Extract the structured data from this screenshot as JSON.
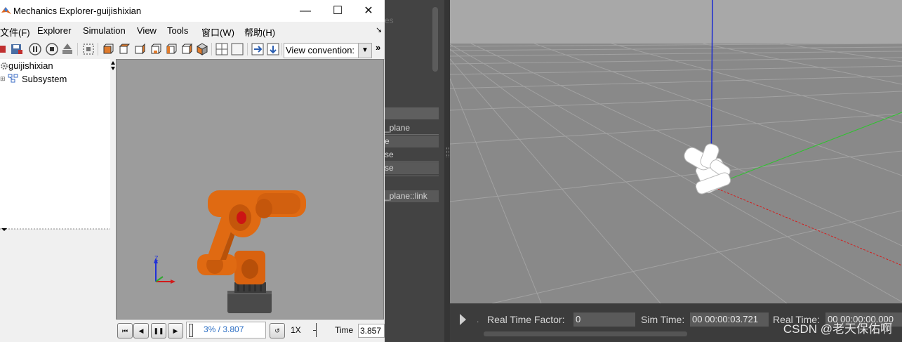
{
  "mechanics": {
    "title": "Mechanics Explorer-guijishixian",
    "menus": [
      {
        "text": "文件(F)"
      },
      {
        "text": "Explorer"
      },
      {
        "text": "Simulation"
      },
      {
        "text": "View"
      },
      {
        "text": "Tools"
      },
      {
        "text": "窗口(W)"
      },
      {
        "text": "帮助(H)"
      }
    ],
    "view_convention_label": "View convention:",
    "tree": {
      "root": "guijishixian",
      "child": "Subsystem"
    },
    "axes_label": "Z",
    "playback": {
      "progress_percent": 3,
      "progress_text": "3% / 3.807",
      "speed": "1X",
      "time_label": "Time",
      "time_value": "3.857"
    }
  },
  "gazebo": {
    "panel_rows": [
      "",
      "_plane",
      "e",
      "se",
      "se",
      "",
      "_plane::link"
    ],
    "partial_label": "es",
    "real_time_factor_label": "Real Time Factor:",
    "real_time_factor_value": "0",
    "sim_time_label": "Sim Time:",
    "sim_time_value": "00 00:00:03.721",
    "real_time_label": "Real Time:",
    "real_time_value": "00 00:00:00.000"
  },
  "watermark": "CSDN @老天保佑啊",
  "colors": {
    "robot_orange": "#e06a12",
    "robot_base": "#4a4a4a",
    "gz_axis_z": "#1a2bd1",
    "gz_axis_y": "#2ec42e",
    "gz_axis_x": "#d61c1c"
  }
}
